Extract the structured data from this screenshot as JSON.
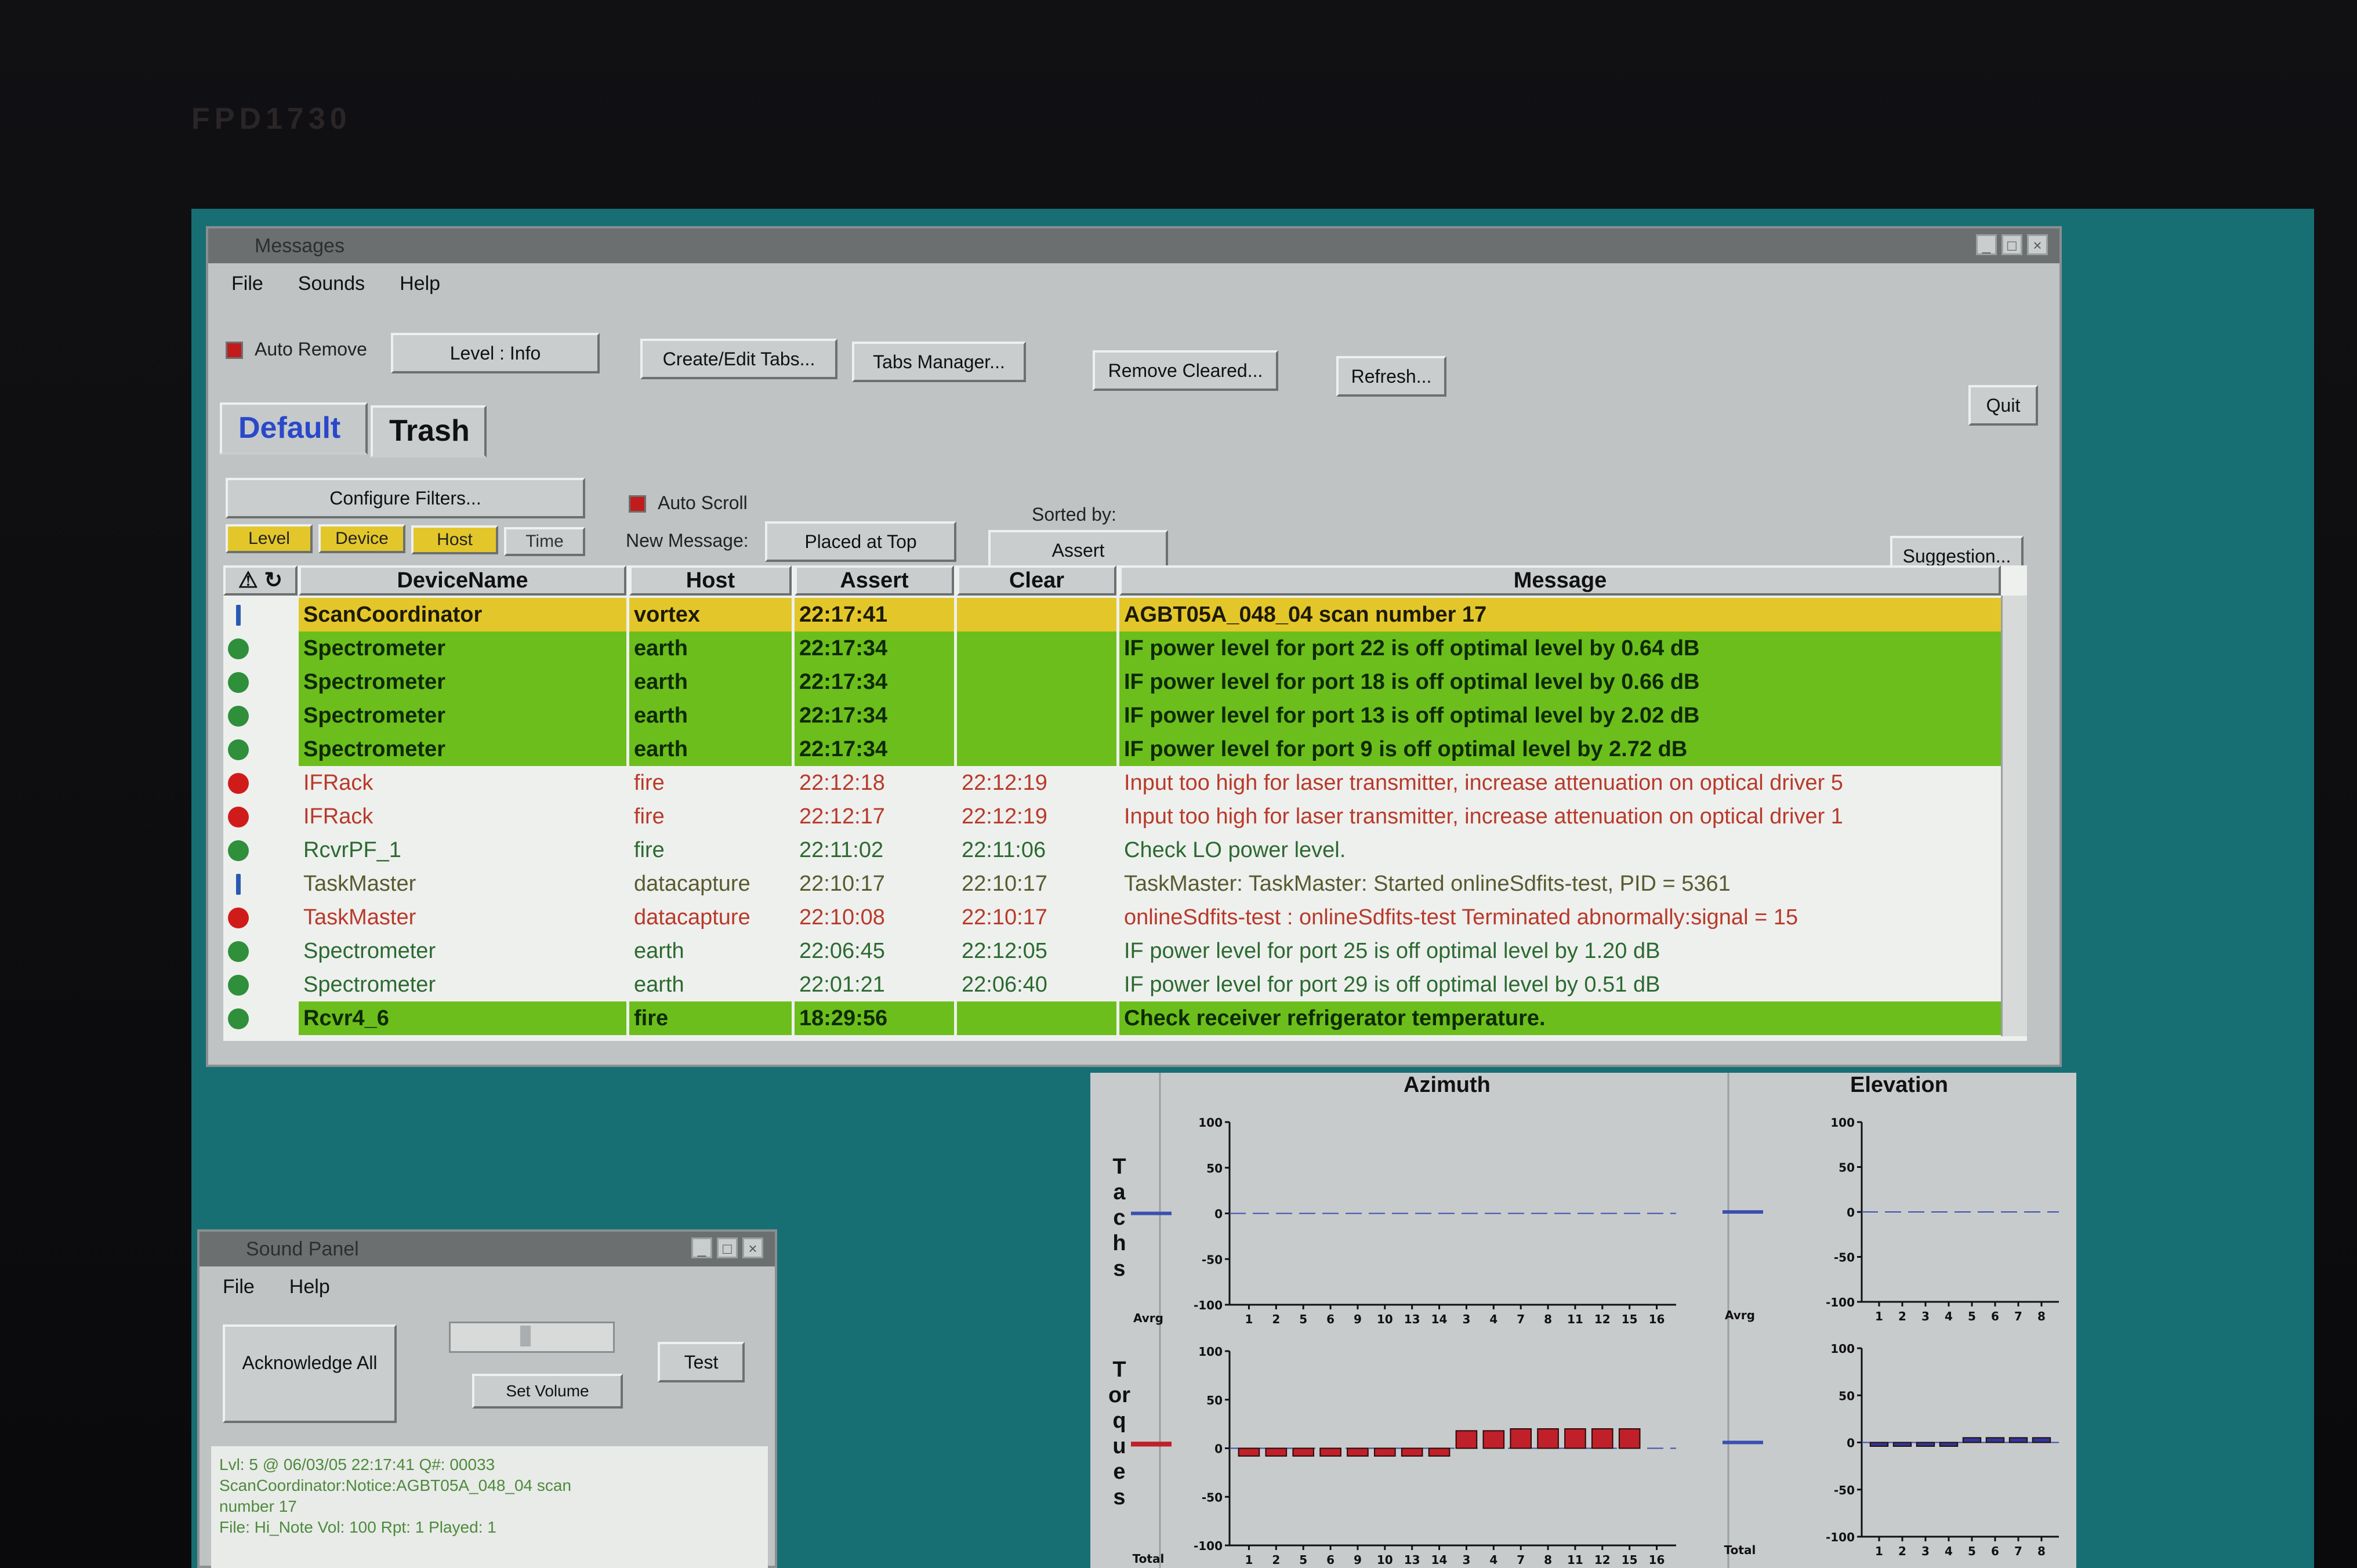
{
  "monitor": {
    "brand": "FPD1730"
  },
  "messages_window": {
    "title": "Messages",
    "menu": [
      "File",
      "Sounds",
      "Help"
    ],
    "toolbar": {
      "auto_remove_label": "Auto Remove",
      "level_button": "Level : Info",
      "create_tabs_button": "Create/Edit Tabs...",
      "tabs_manager_button": "Tabs Manager...",
      "remove_cleared_button": "Remove Cleared...",
      "refresh_button": "Refresh...",
      "quit_button": "Quit"
    },
    "tabs": [
      {
        "label": "Default",
        "active": true
      },
      {
        "label": "Trash",
        "active": false
      }
    ],
    "filters": {
      "configure_button": "Configure Filters...",
      "chips": [
        "Level",
        "Device",
        "Host",
        "Time"
      ],
      "auto_scroll_label": "Auto Scroll",
      "new_message_label": "New Message:",
      "new_message_value": "Placed at Top",
      "sorted_by_label": "Sorted by:",
      "sorted_by_value": "Assert",
      "suggestion_button": "Suggestion..."
    },
    "columns": [
      "DeviceName",
      "Host",
      "Assert",
      "Clear",
      "Message"
    ],
    "rows": [
      {
        "sev": "info",
        "style": "warn",
        "device": "ScanCoordinator",
        "host": "vortex",
        "assert": "22:17:41",
        "clear": "",
        "message": "AGBT05A_048_04 scan number 17"
      },
      {
        "sev": "green",
        "style": "sel",
        "device": "Spectrometer",
        "host": "earth",
        "assert": "22:17:34",
        "clear": "",
        "message": "IF power level for port 22 is off optimal level by 0.64 dB"
      },
      {
        "sev": "green",
        "style": "sel",
        "device": "Spectrometer",
        "host": "earth",
        "assert": "22:17:34",
        "clear": "",
        "message": "IF power level for port 18 is off optimal level by 0.66 dB"
      },
      {
        "sev": "green",
        "style": "sel",
        "device": "Spectrometer",
        "host": "earth",
        "assert": "22:17:34",
        "clear": "",
        "message": "IF power level for port 13 is off optimal level by 2.02 dB"
      },
      {
        "sev": "green",
        "style": "sel",
        "device": "Spectrometer",
        "host": "earth",
        "assert": "22:17:34",
        "clear": "",
        "message": "IF power level for port 9 is off optimal level by 2.72 dB"
      },
      {
        "sev": "red",
        "style": "err",
        "device": "IFRack",
        "host": "fire",
        "assert": "22:12:18",
        "clear": "22:12:19",
        "message": "Input too high for laser transmitter, increase attenuation on optical driver 5"
      },
      {
        "sev": "red",
        "style": "err",
        "device": "IFRack",
        "host": "fire",
        "assert": "22:12:17",
        "clear": "22:12:19",
        "message": "Input too high for laser transmitter, increase attenuation on optical driver 1"
      },
      {
        "sev": "green",
        "style": "ok",
        "device": "RcvrPF_1",
        "host": "fire",
        "assert": "22:11:02",
        "clear": "22:11:06",
        "message": "Check LO power level."
      },
      {
        "sev": "info",
        "style": "info",
        "device": "TaskMaster",
        "host": "datacapture",
        "assert": "22:10:17",
        "clear": "22:10:17",
        "message": "TaskMaster: TaskMaster: Started onlineSdfits-test, PID = 5361"
      },
      {
        "sev": "red",
        "style": "err",
        "device": "TaskMaster",
        "host": "datacapture",
        "assert": "22:10:08",
        "clear": "22:10:17",
        "message": "onlineSdfits-test : onlineSdfits-test Terminated abnormally:signal = 15"
      },
      {
        "sev": "green",
        "style": "ok",
        "device": "Spectrometer",
        "host": "earth",
        "assert": "22:06:45",
        "clear": "22:12:05",
        "message": "IF power level for port 25 is off optimal level by 1.20 dB"
      },
      {
        "sev": "green",
        "style": "ok",
        "device": "Spectrometer",
        "host": "earth",
        "assert": "22:01:21",
        "clear": "22:06:40",
        "message": "IF power level for port 29 is off optimal level by 0.51 dB"
      },
      {
        "sev": "green",
        "style": "sel",
        "device": "Rcvr4_6",
        "host": "fire",
        "assert": "18:29:56",
        "clear": "",
        "message": "Check receiver refrigerator temperature."
      }
    ]
  },
  "charts_panel": {
    "row_labels": {
      "tachs": "Tachs",
      "torques": "Torques"
    },
    "azimuth_title": "Azimuth",
    "elevation_title": "Elevation",
    "colors": {
      "bar": "#c0202a",
      "bar_blue": "#2a3a9a",
      "line": "#3b4fb0"
    }
  },
  "chart_data": [
    {
      "type": "bar",
      "title": "Azimuth",
      "row": "Tachs",
      "ylim": [
        -100,
        100
      ],
      "yticks": [
        "100",
        "50",
        "0",
        "-50",
        "-100"
      ],
      "summary_label": "Avrg",
      "summary_value": 0,
      "categories": [
        "1",
        "2",
        "5",
        "6",
        "9",
        "10",
        "13",
        "14",
        "3",
        "4",
        "7",
        "8",
        "11",
        "12",
        "15",
        "16"
      ],
      "values": [
        0,
        0,
        0,
        0,
        0,
        0,
        0,
        0,
        0,
        0,
        0,
        0,
        0,
        0,
        0,
        0
      ]
    },
    {
      "type": "bar",
      "title": "Elevation",
      "row": "Tachs",
      "ylim": [
        -100,
        100
      ],
      "yticks": [
        "100",
        "50",
        "0",
        "-50",
        "-100"
      ],
      "summary_label": "Avrg",
      "summary_value": 0,
      "categories": [
        "1",
        "2",
        "3",
        "4",
        "5",
        "6",
        "7",
        "8"
      ],
      "values": [
        0,
        0,
        0,
        0,
        0,
        0,
        0,
        0
      ]
    },
    {
      "type": "bar",
      "row": "Torques",
      "ylim": [
        -100,
        100
      ],
      "yticks": [
        "100",
        "50",
        "0",
        "-50",
        "-100"
      ],
      "summary_label": "Total",
      "summary_value": 5,
      "categories": [
        "1",
        "2",
        "5",
        "6",
        "9",
        "10",
        "13",
        "14",
        "3",
        "4",
        "7",
        "8",
        "11",
        "12",
        "15",
        "16"
      ],
      "values": [
        -8,
        -8,
        -8,
        -8,
        -8,
        -8,
        -8,
        -8,
        18,
        18,
        20,
        20,
        20,
        20,
        20,
        0
      ]
    },
    {
      "type": "bar",
      "row": "Torques",
      "ylim": [
        -100,
        100
      ],
      "yticks": [
        "100",
        "50",
        "0",
        "-50",
        "-100"
      ],
      "summary_label": "Total",
      "summary_value": 0,
      "categories": [
        "1",
        "2",
        "3",
        "4",
        "5",
        "6",
        "7",
        "8"
      ],
      "values": [
        -4,
        -4,
        -4,
        -4,
        5,
        5,
        5,
        5
      ]
    }
  ],
  "sound_panel": {
    "title": "Sound Panel",
    "menu": [
      "File",
      "Help"
    ],
    "acknowledge_button": "Acknowledge All",
    "test_button": "Test",
    "set_volume_label": "Set Volume",
    "log_lines": [
      "Lvl: 5 @ 06/03/05 22:17:41  Q#: 00033",
      "ScanCoordinator:Notice:AGBT05A_048_04 scan",
      "number 17",
      "File: Hi_Note   Vol: 100  Rpt: 1   Played: 1"
    ]
  }
}
